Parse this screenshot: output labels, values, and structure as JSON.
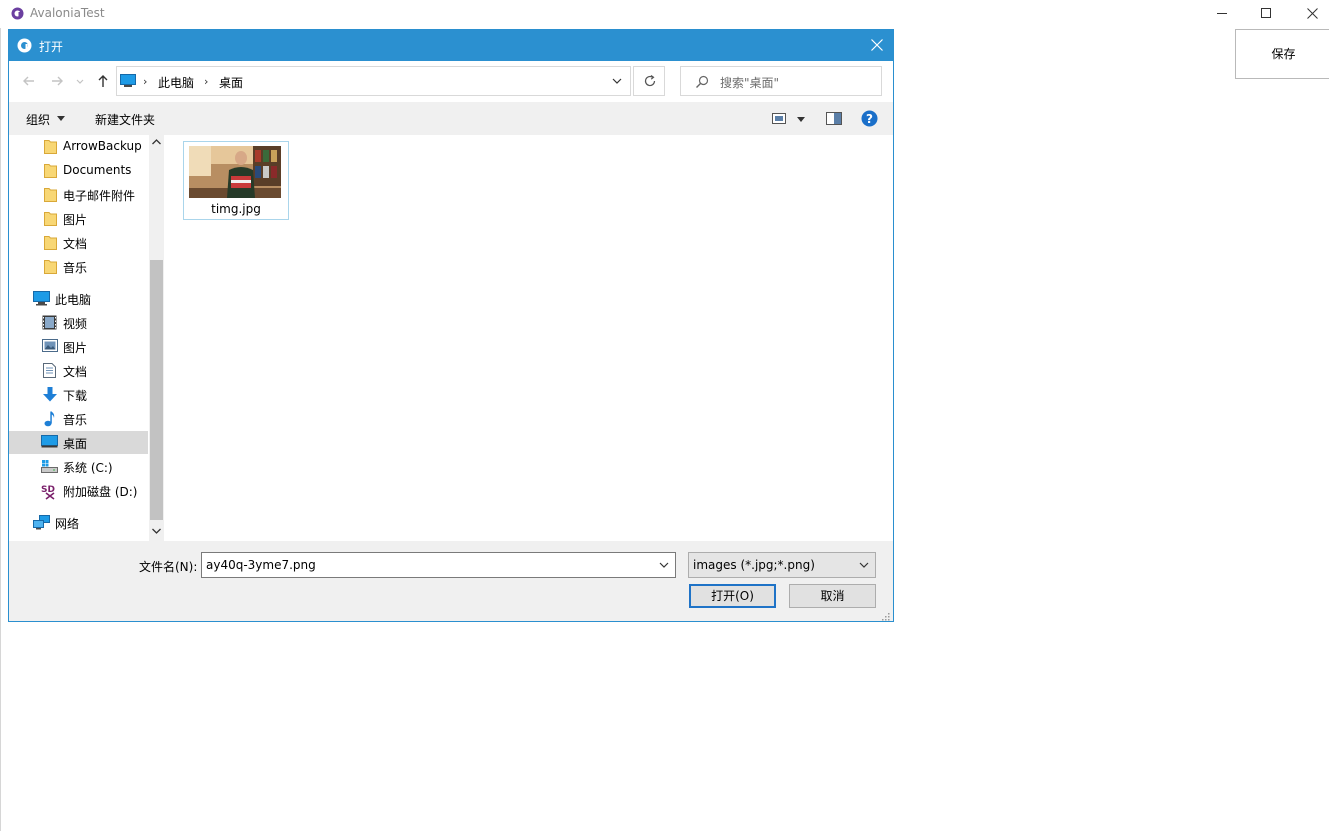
{
  "app": {
    "title": "AvaloniaTest",
    "save_label": "保存"
  },
  "dialog": {
    "title": "打开",
    "breadcrumb": [
      "此电脑",
      "桌面"
    ],
    "search_placeholder": "搜索\"桌面\"",
    "toolbar": {
      "organize_label": "组织",
      "new_folder_label": "新建文件夹"
    },
    "nav": {
      "quick_access": [
        {
          "label": "ArrowBackup",
          "icon": "folder-icon"
        },
        {
          "label": "Documents",
          "icon": "folder-icon"
        },
        {
          "label": "电子邮件附件",
          "icon": "folder-icon"
        },
        {
          "label": "图片",
          "icon": "folder-icon"
        },
        {
          "label": "文档",
          "icon": "folder-icon"
        },
        {
          "label": "音乐",
          "icon": "folder-icon"
        }
      ],
      "this_pc_label": "此电脑",
      "this_pc_items": [
        {
          "label": "视频",
          "icon": "video-icon"
        },
        {
          "label": "图片",
          "icon": "pictures-icon"
        },
        {
          "label": "文档",
          "icon": "documents-icon"
        },
        {
          "label": "下载",
          "icon": "download-icon"
        },
        {
          "label": "音乐",
          "icon": "music-icon"
        },
        {
          "label": "桌面",
          "icon": "desktop-icon"
        },
        {
          "label": "系统 (C:)",
          "icon": "drive-icon"
        },
        {
          "label": "附加磁盘 (D:)",
          "icon": "sd-drive-icon"
        }
      ],
      "network_label": "网络",
      "selected": "桌面"
    },
    "files": [
      {
        "name": "timg.jpg",
        "type": "image"
      }
    ],
    "filename_label": "文件名(N):",
    "filename_value": "ay40q-3yme7.png",
    "filetype_value": "images (*.jpg;*.png)",
    "open_label": "打开(O)",
    "cancel_label": "取消"
  },
  "colors": {
    "dialog_titlebar": "#2b90d0",
    "selection": "#d9d9d9",
    "accent": "#1f73c7"
  }
}
